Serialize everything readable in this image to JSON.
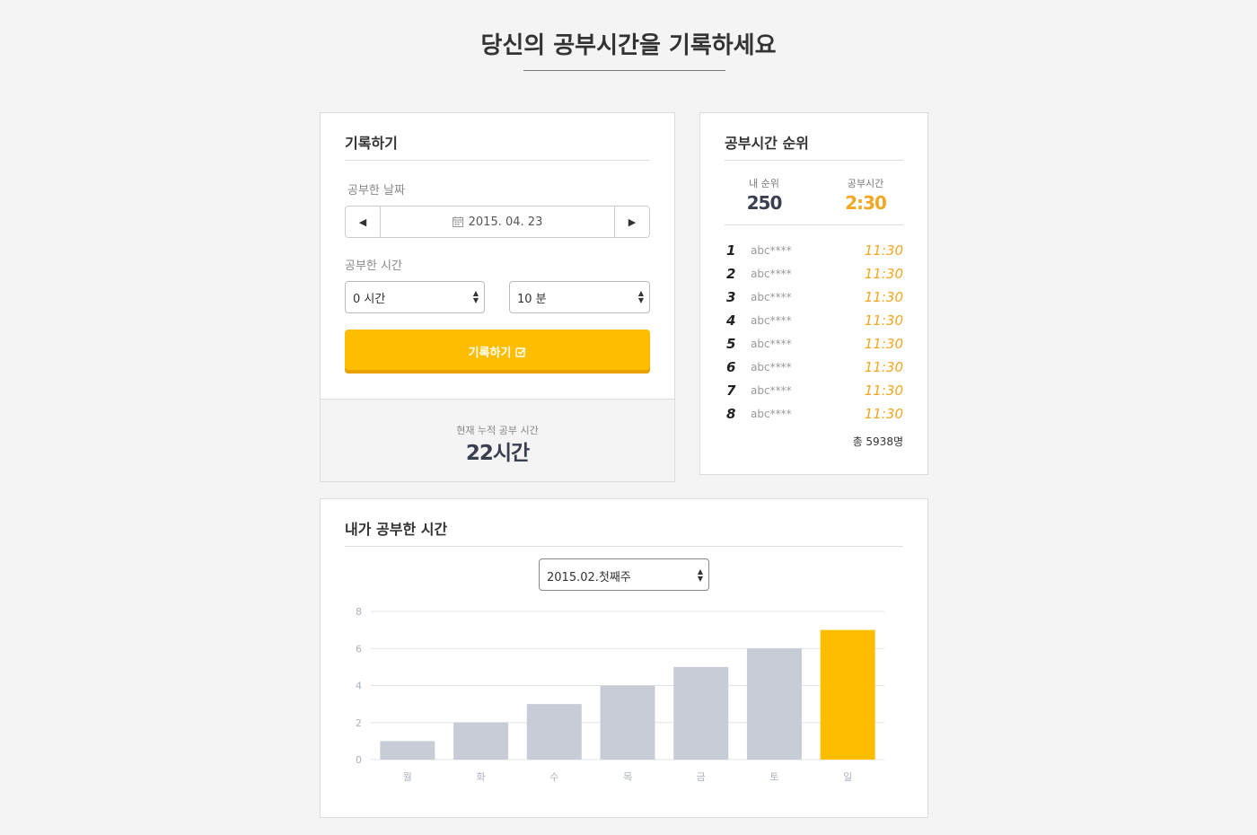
{
  "header": {
    "title": "당신의 공부시간을 기록하세요"
  },
  "record": {
    "title": "기록하기",
    "date_label": "공부한 날짜",
    "date_value": "2015. 04. 23",
    "time_label": "공부한 시간",
    "hours_value": "0 시간",
    "minutes_value": "10 분",
    "submit_label": "기록하기",
    "total_label": "현재 누적 공부 시간",
    "total_value": "22시간"
  },
  "ranking": {
    "title": "공부시간 순위",
    "my_rank_label": "내 순위",
    "my_rank_value": "250",
    "my_time_label": "공부시간",
    "my_time_value": "2:30",
    "rows": [
      {
        "rank": "1",
        "user": "abc****",
        "time": "11:30"
      },
      {
        "rank": "2",
        "user": "abc****",
        "time": "11:30"
      },
      {
        "rank": "3",
        "user": "abc****",
        "time": "11:30"
      },
      {
        "rank": "4",
        "user": "abc****",
        "time": "11:30"
      },
      {
        "rank": "5",
        "user": "abc****",
        "time": "11:30"
      },
      {
        "rank": "6",
        "user": "abc****",
        "time": "11:30"
      },
      {
        "rank": "7",
        "user": "abc****",
        "time": "11:30"
      },
      {
        "rank": "8",
        "user": "abc****",
        "time": "11:30"
      }
    ],
    "total_users": "총 5938명"
  },
  "chart_section": {
    "title": "내가 공부한 시간",
    "week_value": "2015.02.첫째주"
  },
  "colors": {
    "accent": "#ffbd00",
    "bar_default": "#c8ccd6",
    "time_orange": "#f5a623",
    "rank_dark": "#3a3f50"
  },
  "icons": {
    "prev": "caret-left-icon",
    "next": "caret-right-icon",
    "calendar": "calendar-icon",
    "check": "check-square-icon",
    "select": "updown-arrows-icon"
  },
  "chart_data": {
    "type": "bar",
    "categories": [
      "월",
      "화",
      "수",
      "목",
      "금",
      "토",
      "일"
    ],
    "values": [
      1,
      2,
      3,
      4,
      5,
      6,
      7
    ],
    "highlight_index": 6,
    "ylim": [
      0,
      8
    ],
    "yticks": [
      0,
      2,
      4,
      6,
      8
    ],
    "grid": true,
    "title": "",
    "xlabel": "",
    "ylabel": ""
  }
}
